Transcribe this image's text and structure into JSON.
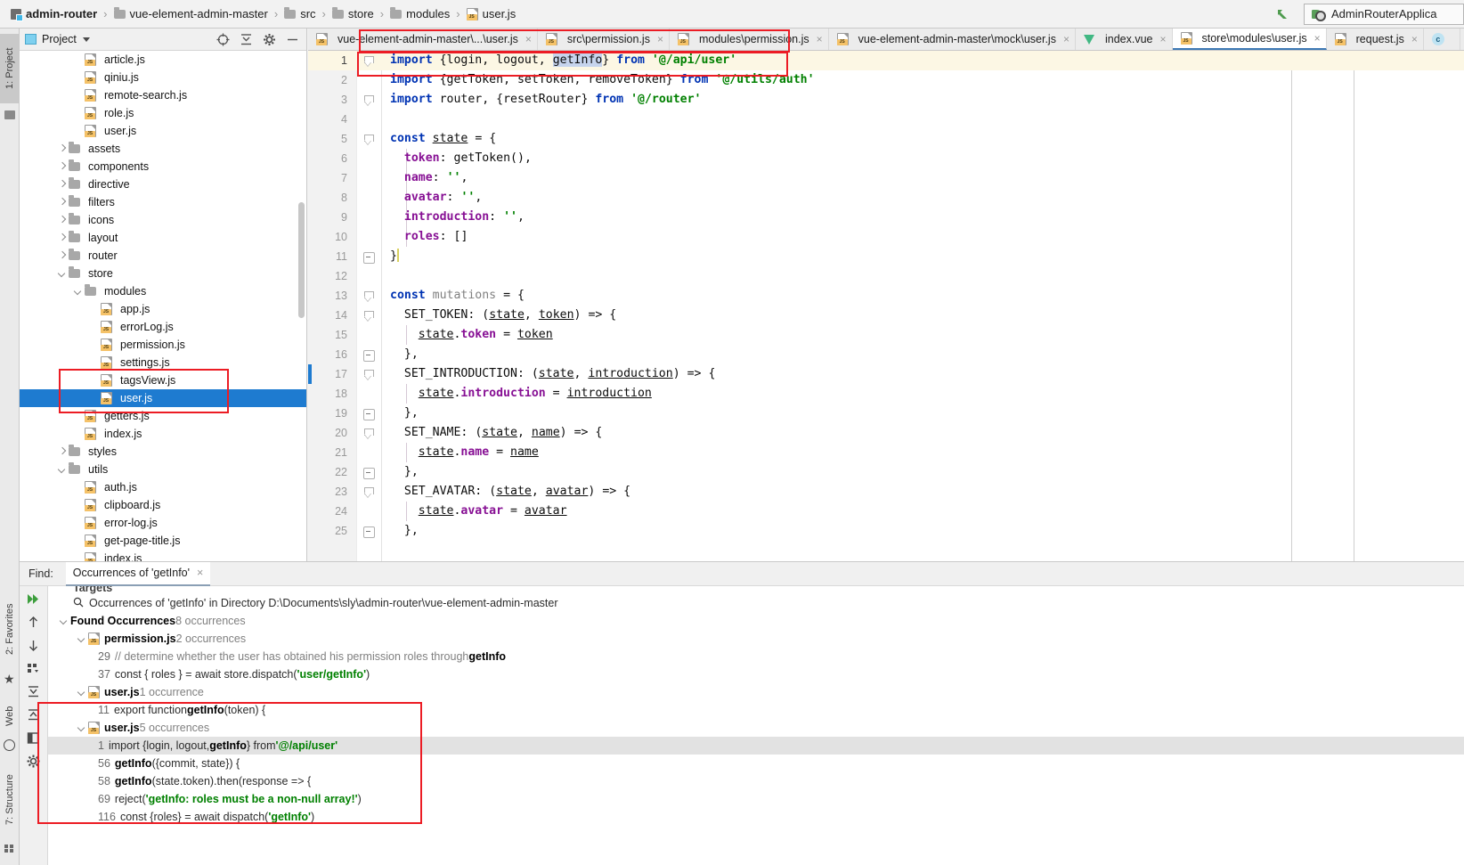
{
  "navbar": {
    "breadcrumbs": [
      {
        "label": "admin-router",
        "icon": "module-icon"
      },
      {
        "label": "vue-element-admin-master",
        "icon": "folder-icon"
      },
      {
        "label": "src",
        "icon": "folder-icon"
      },
      {
        "label": "store",
        "icon": "folder-icon"
      },
      {
        "label": "modules",
        "icon": "folder-icon"
      },
      {
        "label": "user.js",
        "icon": "js-file-icon"
      }
    ],
    "separator": "›",
    "run_config": "AdminRouterApplica"
  },
  "left_strips": {
    "top": [
      {
        "label": "1: Project",
        "selected": true
      }
    ],
    "bottom": [
      {
        "label": "2: Favorites",
        "selected": false
      },
      {
        "label": "Web",
        "selected": false
      },
      {
        "label": "7: Structure",
        "selected": false
      }
    ]
  },
  "project": {
    "title": "Project",
    "toolbar_icons": [
      "locate-icon",
      "collapse-all-icon",
      "gear-icon",
      "minimize-icon"
    ],
    "tree": [
      {
        "depth": 3,
        "label": "article.js",
        "icon": "js-file-icon",
        "arrow": "none"
      },
      {
        "depth": 3,
        "label": "qiniu.js",
        "icon": "js-file-icon",
        "arrow": "none"
      },
      {
        "depth": 3,
        "label": "remote-search.js",
        "icon": "js-file-icon",
        "arrow": "none"
      },
      {
        "depth": 3,
        "label": "role.js",
        "icon": "js-file-icon",
        "arrow": "none"
      },
      {
        "depth": 3,
        "label": "user.js",
        "icon": "js-file-icon",
        "arrow": "none"
      },
      {
        "depth": 2,
        "label": "assets",
        "icon": "folder-icon",
        "arrow": "closed"
      },
      {
        "depth": 2,
        "label": "components",
        "icon": "folder-icon",
        "arrow": "closed"
      },
      {
        "depth": 2,
        "label": "directive",
        "icon": "folder-icon",
        "arrow": "closed"
      },
      {
        "depth": 2,
        "label": "filters",
        "icon": "folder-icon",
        "arrow": "closed"
      },
      {
        "depth": 2,
        "label": "icons",
        "icon": "folder-icon",
        "arrow": "closed"
      },
      {
        "depth": 2,
        "label": "layout",
        "icon": "folder-icon",
        "arrow": "closed"
      },
      {
        "depth": 2,
        "label": "router",
        "icon": "folder-icon",
        "arrow": "closed"
      },
      {
        "depth": 2,
        "label": "store",
        "icon": "folder-icon",
        "arrow": "open"
      },
      {
        "depth": 3,
        "label": "modules",
        "icon": "folder-icon",
        "arrow": "open"
      },
      {
        "depth": 4,
        "label": "app.js",
        "icon": "js-file-icon",
        "arrow": "none"
      },
      {
        "depth": 4,
        "label": "errorLog.js",
        "icon": "js-file-icon",
        "arrow": "none"
      },
      {
        "depth": 4,
        "label": "permission.js",
        "icon": "js-file-icon",
        "arrow": "none"
      },
      {
        "depth": 4,
        "label": "settings.js",
        "icon": "js-file-icon",
        "arrow": "none"
      },
      {
        "depth": 4,
        "label": "tagsView.js",
        "icon": "js-file-icon",
        "arrow": "none"
      },
      {
        "depth": 4,
        "label": "user.js",
        "icon": "js-file-icon",
        "arrow": "none",
        "selected": true
      },
      {
        "depth": 3,
        "label": "getters.js",
        "icon": "js-file-icon",
        "arrow": "none"
      },
      {
        "depth": 3,
        "label": "index.js",
        "icon": "js-file-icon",
        "arrow": "none"
      },
      {
        "depth": 2,
        "label": "styles",
        "icon": "folder-icon",
        "arrow": "closed"
      },
      {
        "depth": 2,
        "label": "utils",
        "icon": "folder-icon",
        "arrow": "open"
      },
      {
        "depth": 3,
        "label": "auth.js",
        "icon": "js-file-icon",
        "arrow": "none"
      },
      {
        "depth": 3,
        "label": "clipboard.js",
        "icon": "js-file-icon",
        "arrow": "none"
      },
      {
        "depth": 3,
        "label": "error-log.js",
        "icon": "js-file-icon",
        "arrow": "none"
      },
      {
        "depth": 3,
        "label": "get-page-title.js",
        "icon": "js-file-icon",
        "arrow": "none"
      },
      {
        "depth": 3,
        "label": "index.js",
        "icon": "js-file-icon",
        "arrow": "none"
      }
    ]
  },
  "editor": {
    "tabs": [
      {
        "label": "vue-element-admin-master\\...\\user.js",
        "icon": "js-file-icon",
        "active": false
      },
      {
        "label": "src\\permission.js",
        "icon": "js-file-icon",
        "active": false
      },
      {
        "label": "modules\\permission.js",
        "icon": "js-file-icon",
        "active": false
      },
      {
        "label": "vue-element-admin-master\\mock\\user.js",
        "icon": "js-file-icon",
        "active": false
      },
      {
        "label": "index.vue",
        "icon": "vue-file-icon",
        "active": false
      },
      {
        "label": "store\\modules\\user.js",
        "icon": "js-file-icon",
        "active": true
      },
      {
        "label": "request.js",
        "icon": "js-file-icon",
        "active": false
      },
      {
        "label": "",
        "icon": "c-file-icon",
        "active": false
      }
    ],
    "close_glyph": "×",
    "lines": [
      {
        "n": "1",
        "text": "import {login, logout, getInfo} from '@/api/user'"
      },
      {
        "n": "2",
        "text": "import {getToken, setToken, removeToken} from '@/utils/auth'"
      },
      {
        "n": "3",
        "text": "import router, {resetRouter} from '@/router'"
      },
      {
        "n": "4",
        "text": ""
      },
      {
        "n": "5",
        "text": "const state = {"
      },
      {
        "n": "6",
        "text": "  token: getToken(),"
      },
      {
        "n": "7",
        "text": "  name: '',"
      },
      {
        "n": "8",
        "text": "  avatar: '',"
      },
      {
        "n": "9",
        "text": "  introduction: '',"
      },
      {
        "n": "10",
        "text": "  roles: []"
      },
      {
        "n": "11",
        "text": "}"
      },
      {
        "n": "12",
        "text": ""
      },
      {
        "n": "13",
        "text": "const mutations = {"
      },
      {
        "n": "14",
        "text": "  SET_TOKEN: (state, token) => {"
      },
      {
        "n": "15",
        "text": "    state.token = token"
      },
      {
        "n": "16",
        "text": "  },"
      },
      {
        "n": "17",
        "text": "  SET_INTRODUCTION: (state, introduction) => {"
      },
      {
        "n": "18",
        "text": "    state.introduction = introduction"
      },
      {
        "n": "19",
        "text": "  },"
      },
      {
        "n": "20",
        "text": "  SET_NAME: (state, name) => {"
      },
      {
        "n": "21",
        "text": "    state.name = name"
      },
      {
        "n": "22",
        "text": "  },"
      },
      {
        "n": "23",
        "text": "  SET_AVATAR: (state, avatar) => {"
      },
      {
        "n": "24",
        "text": "    state.avatar = avatar"
      },
      {
        "n": "25",
        "text": "  },"
      }
    ]
  },
  "find": {
    "label": "Find:",
    "tab_title": "Occurrences of 'getInfo'",
    "close_glyph": "×",
    "toolbar_icons": [
      "run-all-icon",
      "previous-occurrence-icon",
      "next-occurrence-icon",
      "group-by-icon",
      "expand-all-icon",
      "collapse-all-icon",
      "preview-icon",
      "settings-icon"
    ],
    "targets_header": "Targets",
    "scope_line": "Occurrences of 'getInfo' in Directory D:\\Documents\\sly\\admin-router\\vue-element-admin-master",
    "found_header": "Found Occurrences",
    "found_count": "8 occurrences",
    "groups": [
      {
        "file": "permission.js",
        "count": "2 occurrences",
        "results": [
          {
            "line": "29",
            "text": "// determine whether the user has obtained his permission roles through getInfo"
          },
          {
            "line": "37",
            "text": "const { roles } = await store.dispatch('user/getInfo')"
          }
        ]
      },
      {
        "file": "user.js",
        "count": "1 occurrence",
        "results": [
          {
            "line": "11",
            "text": "export function getInfo(token) {"
          }
        ]
      },
      {
        "file": "user.js",
        "count": "5 occurrences",
        "results": [
          {
            "line": "1",
            "text": "import {login, logout, getInfo} from '@/api/user'",
            "selected": true
          },
          {
            "line": "56",
            "text": "getInfo({commit, state}) {"
          },
          {
            "line": "58",
            "text": "getInfo(state.token).then(response => {"
          },
          {
            "line": "69",
            "text": "reject('getInfo: roles must be a non-null array!')"
          },
          {
            "line": "116",
            "text": "const {roles} = await dispatch('getInfo')"
          }
        ]
      }
    ]
  },
  "annotations": {
    "highlight_color": "#ec1c24",
    "boxes": [
      {
        "name": "import-line-highlight"
      },
      {
        "name": "editor-tabs-highlight"
      },
      {
        "name": "tree-user-js-highlight"
      },
      {
        "name": "find-results-highlight"
      }
    ]
  }
}
